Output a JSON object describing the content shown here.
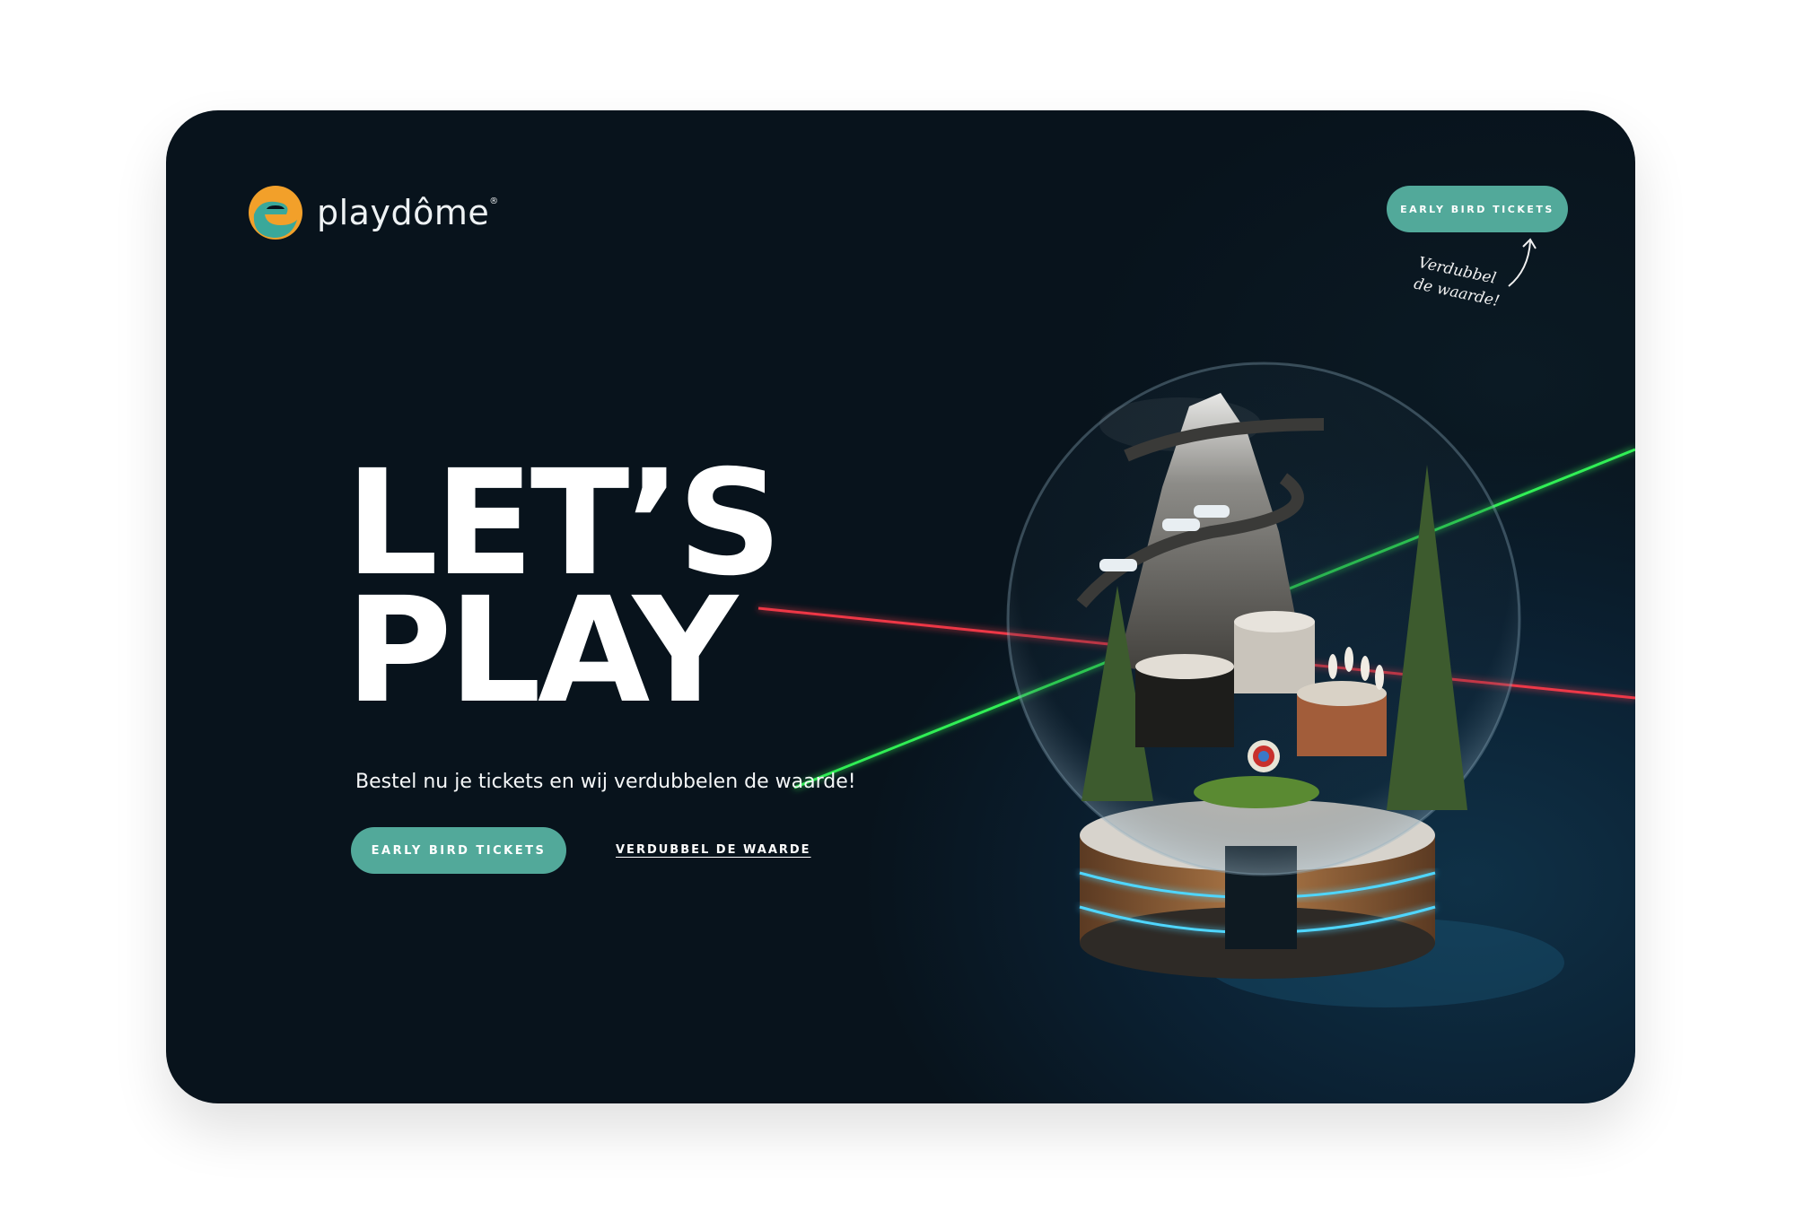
{
  "brand": {
    "name": "playdôme",
    "reg": "®"
  },
  "header": {
    "cta_label": "EARLY BIRD TICKETS",
    "note_line1": "Verdubbel",
    "note_line2": "de waarde!"
  },
  "hero": {
    "line1": "LET’S",
    "line2": "PLAY",
    "subtitle": "Bestel nu je tickets en wij verdubbelen de waarde!",
    "cta_label": "EARLY BIRD TICKETS",
    "link_label": "VERDUBBEL DE WAARDE"
  },
  "colors": {
    "accent": "#52a99a",
    "background": "#08131c",
    "logo_orange": "#f2a02a",
    "logo_teal": "#3aa89a"
  }
}
